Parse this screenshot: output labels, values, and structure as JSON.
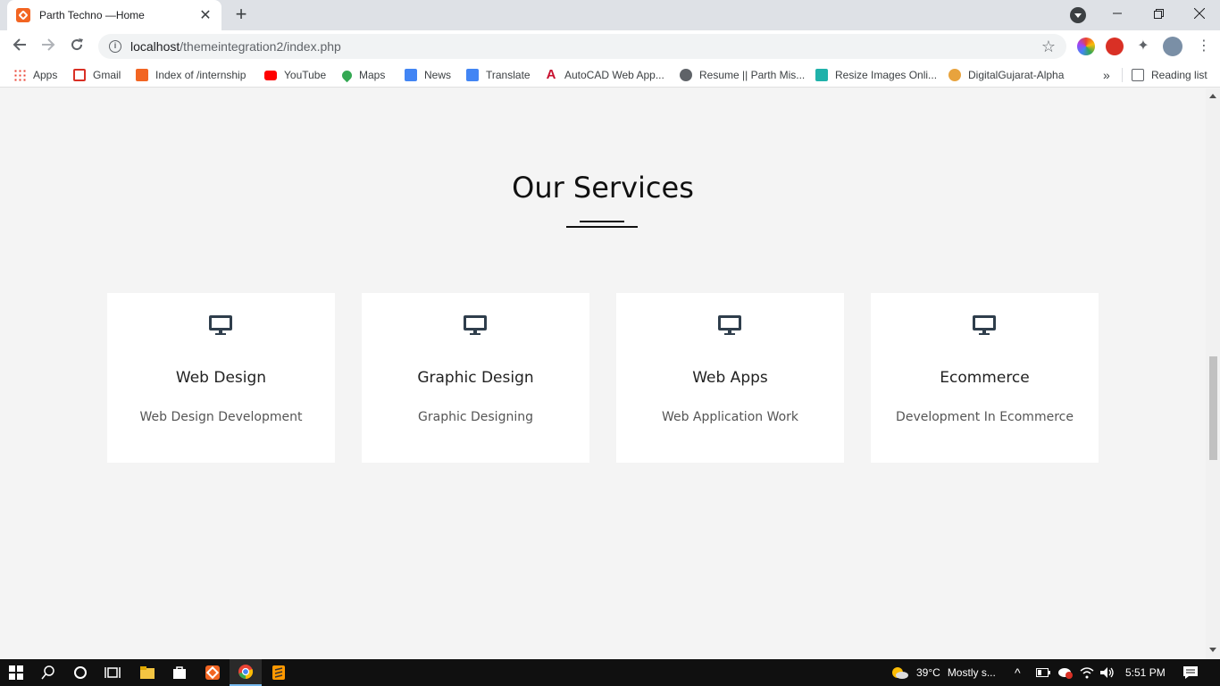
{
  "browser": {
    "tab_title": "Parth Techno —Home",
    "url_host": "localhost",
    "url_path": "/themeintegration2/index.php",
    "bookmarks": [
      {
        "label": "Apps",
        "color": "#ea4335"
      },
      {
        "label": "Gmail",
        "color": "#d93025"
      },
      {
        "label": "Index of /internship",
        "color": "#f26522"
      },
      {
        "label": "YouTube",
        "color": "#ff0000"
      },
      {
        "label": "Maps",
        "color": "#34a853"
      },
      {
        "label": "News",
        "color": "#4285f4"
      },
      {
        "label": "Translate",
        "color": "#4285f4"
      },
      {
        "label": "AutoCAD Web App...",
        "color": "#c8102e"
      },
      {
        "label": "Resume || Parth Mis...",
        "color": "#5f6368"
      },
      {
        "label": "Resize Images Onli...",
        "color": "#20b2aa"
      },
      {
        "label": "DigitalGujarat-Alpha",
        "color": "#e8a33d"
      }
    ],
    "more_bookmarks": "»",
    "reading_list": "Reading list"
  },
  "services": {
    "title": "Our Services",
    "items": [
      {
        "title": "Web Design",
        "desc": "Web Design Development",
        "icon": "desktop-icon"
      },
      {
        "title": "Graphic Design",
        "desc": "Graphic Designing",
        "icon": "desktop-icon"
      },
      {
        "title": "Web Apps",
        "desc": "Web Application Work",
        "icon": "desktop-icon"
      },
      {
        "title": "Ecommerce",
        "desc": "Development In Ecommerce",
        "icon": "desktop-icon"
      }
    ]
  },
  "taskbar": {
    "weather": "39°C",
    "weather_desc": "Mostly s...",
    "time": "5:51 PM"
  },
  "colors": {
    "accent": "#2f3e4c",
    "page_bg": "#f4f4f4"
  }
}
